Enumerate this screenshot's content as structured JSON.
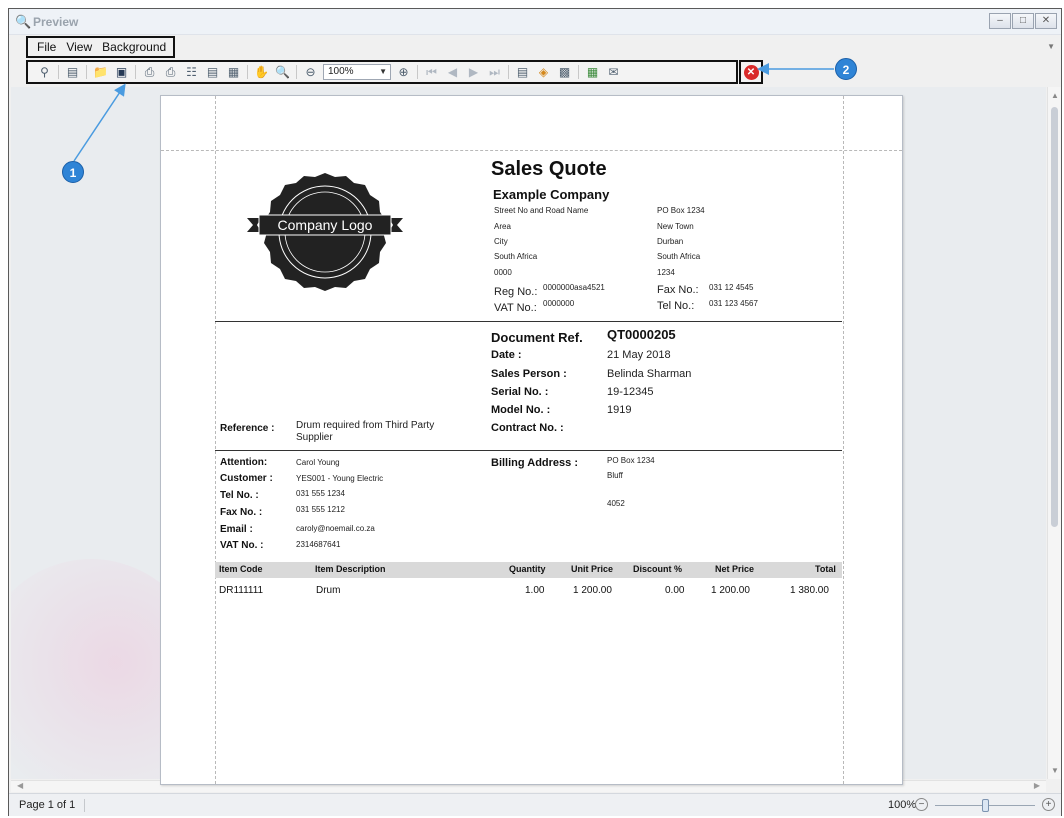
{
  "window": {
    "title": "Preview"
  },
  "menu": {
    "items": [
      "File",
      "View",
      "Background"
    ]
  },
  "toolbar": {
    "zoom_value": "100%"
  },
  "annotations": {
    "callout_1": "1",
    "callout_2": "2"
  },
  "status": {
    "page": "Page 1 of 1",
    "zoom": "100%"
  },
  "zoom_slider_level": 0.5,
  "document": {
    "logo_text": "Company Logo",
    "title": "Sales Quote",
    "company_name": "Example Company",
    "address_left": [
      "Street No and Road Name",
      "Area",
      "City",
      "South Africa",
      "0000"
    ],
    "address_right": [
      "PO Box 1234",
      "New Town",
      "Durban",
      "South Africa",
      "1234"
    ],
    "reg_label": "Reg No.:",
    "reg_value": "0000000asa4521",
    "vat_label": "VAT No.:",
    "vat_value": "0000000",
    "fax_label": "Fax No.:",
    "fax_value": "031 12 4545",
    "tel_label": "Tel No.:",
    "tel_value": "031 123 4567",
    "doc_ref_label": "Document Ref.",
    "doc_ref_value": "QT0000205",
    "date_label": "Date :",
    "date_value": "21 May 2018",
    "sales_person_label": "Sales Person :",
    "sales_person_value": "Belinda Sharman",
    "serial_label": "Serial No. :",
    "serial_value": "19-12345",
    "model_label": "Model No. :",
    "model_value": "1919",
    "contract_label": "Contract No. :",
    "reference_label": "Reference :",
    "reference_value_line1": "Drum required from Third Party",
    "reference_value_line2": "Supplier",
    "attention_label": "Attention:",
    "attention_value": "Carol Young",
    "customer_label": "Customer :",
    "customer_value": "YES001 - Young Electric",
    "cust_tel_label": "Tel No. :",
    "cust_tel_value": "031 555 1234",
    "cust_fax_label": "Fax No. :",
    "cust_fax_value": "031 555 1212",
    "email_label": "Email :",
    "email_value": "caroly@noemail.co.za",
    "cust_vat_label": "VAT No. :",
    "cust_vat_value": "2314687641",
    "billing_label": "Billing Address :",
    "billing_lines": [
      "PO Box 1234",
      "Bluff",
      "",
      "4052"
    ],
    "items_header": {
      "item_code": "Item Code",
      "item_description": "Item Description",
      "quantity": "Quantity",
      "unit_price": "Unit Price",
      "discount": "Discount %",
      "net_price": "Net Price",
      "total": "Total"
    },
    "items": [
      {
        "item_code": "DR111111",
        "item_description": "Drum",
        "quantity": "1.00",
        "unit_price": "1 200.00",
        "discount": "0.00",
        "net_price": "1 200.00",
        "total": "1 380.00"
      }
    ]
  }
}
